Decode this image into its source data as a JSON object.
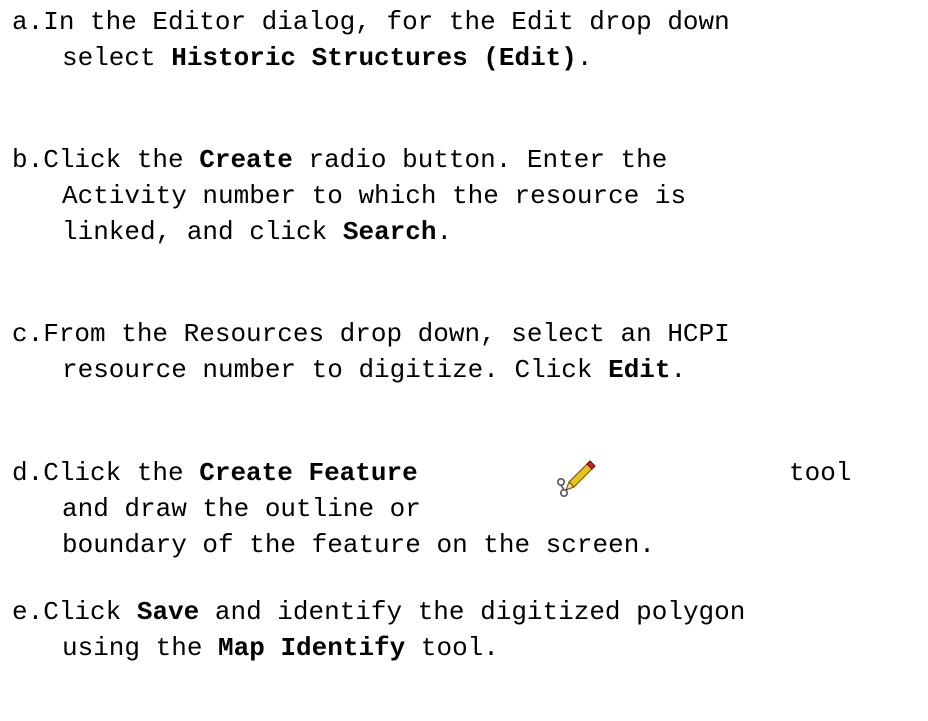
{
  "steps": [
    {
      "letter": "a.",
      "lines": [
        {
          "text": "In the Editor dialog, for the Edit drop down"
        },
        {
          "text": "select ",
          "bold": "Historic Structures (Edit)",
          "after": "."
        }
      ]
    },
    {
      "letter": "b.",
      "lines": [
        {
          "text": "Click the ",
          "bold": "Create",
          "after": " radio button. Enter the"
        },
        {
          "text": "Activity number to which the resource is"
        },
        {
          "text": "linked, and click ",
          "bold": "Search",
          "after": "."
        }
      ]
    },
    {
      "letter": "c.",
      "lines": [
        {
          "text": "From the Resources drop down, select an HCPI"
        },
        {
          "text": "resource number to digitize. Click ",
          "bold": "Edit",
          "after": "."
        }
      ]
    },
    {
      "letter": "d.",
      "lines": [
        {
          "text": "Click the ",
          "bold": "Create Feature"
        },
        {
          "text": "and draw the outline or"
        },
        {
          "text": "boundary of the feature on the screen."
        }
      ],
      "inline_word": "tool",
      "icon": "create-feature-pencil-icon"
    },
    {
      "letter": "e.",
      "lines": [
        {
          "text": "Click ",
          "bold": "Save",
          "after": " and identify the digitized polygon"
        },
        {
          "text": "using the ",
          "bold": "Map Identify",
          "after": " tool."
        }
      ]
    }
  ]
}
